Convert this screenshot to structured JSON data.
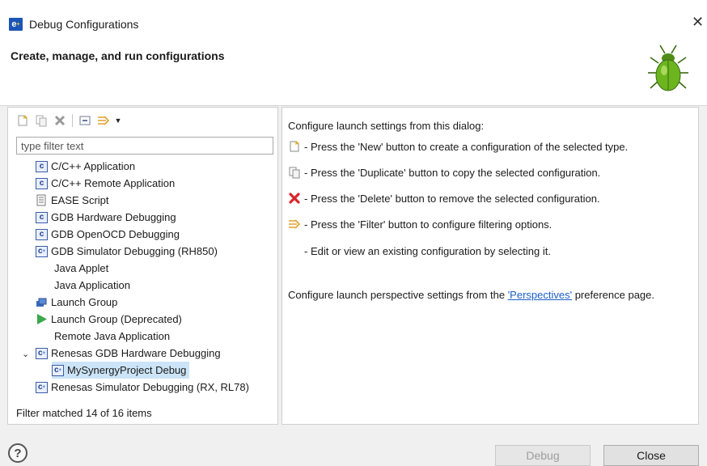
{
  "window": {
    "title": "Debug Configurations"
  },
  "banner": {
    "title": "Create, manage, and run configurations"
  },
  "filter": {
    "placeholder": "type filter text"
  },
  "tree": {
    "items": [
      {
        "label": "C/C++ Application"
      },
      {
        "label": "C/C++ Remote Application"
      },
      {
        "label": "EASE Script"
      },
      {
        "label": "GDB Hardware Debugging"
      },
      {
        "label": "GDB OpenOCD Debugging"
      },
      {
        "label": "GDB Simulator Debugging (RH850)"
      },
      {
        "label": "Java Applet"
      },
      {
        "label": "Java Application"
      },
      {
        "label": "Launch Group"
      },
      {
        "label": "Launch Group (Deprecated)"
      },
      {
        "label": "Remote Java Application"
      },
      {
        "label": "Renesas GDB Hardware Debugging"
      },
      {
        "label": "MySynergyProject Debug"
      },
      {
        "label": "Renesas Simulator Debugging (RX, RL78)"
      }
    ],
    "status": "Filter matched 14 of 16 items"
  },
  "info": {
    "intro": "Configure launch settings from this dialog:",
    "new_line": "- Press the 'New' button to create a configuration of the selected type.",
    "duplicate_line": "- Press the 'Duplicate' button to copy the selected configuration.",
    "delete_line": "- Press the 'Delete' button to remove the selected configuration.",
    "filter_line": "- Press the 'Filter' button to configure filtering options.",
    "edit_line": "- Edit or view an existing configuration by selecting it.",
    "perspective_prefix": "Configure launch perspective settings from the ",
    "perspective_link": "'Perspectives'",
    "perspective_suffix": " preference page."
  },
  "buttons": {
    "help": "?",
    "debug": "Debug",
    "close": "Close"
  }
}
